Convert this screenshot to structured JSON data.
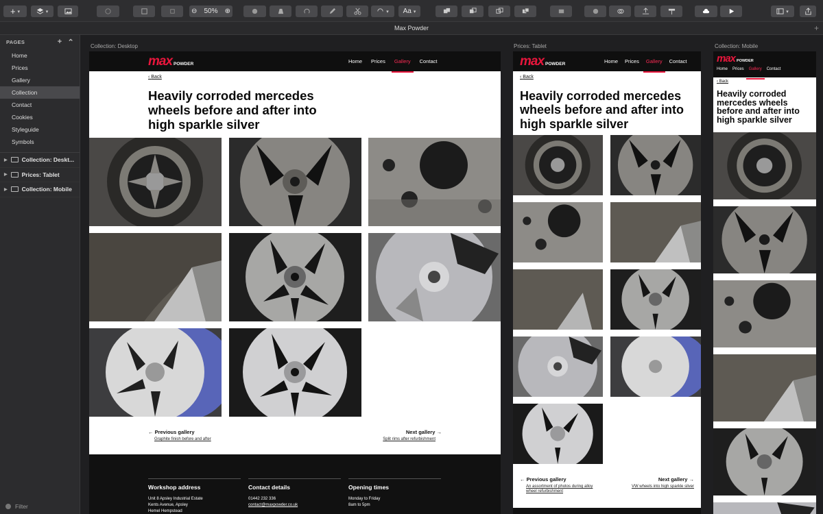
{
  "toolbar": {
    "zoom": "50%",
    "font_button": "Aa"
  },
  "document_title": "Max Powder",
  "sidebar": {
    "header": "PAGES",
    "pages": [
      "Home",
      "Prices",
      "Gallery",
      "Collection",
      "Contact",
      "Cookies",
      "Styleguide",
      "Symbols"
    ],
    "selected_page": "Collection",
    "layers": [
      "Collection: Deskt...",
      "Prices: Tablet",
      "Collection: Mobile"
    ],
    "filter": "Filter"
  },
  "artboards": {
    "desktop": {
      "label": "Collection: Desktop"
    },
    "tablet": {
      "label": "Prices: Tablet"
    },
    "mobile": {
      "label": "Collection: Mobile"
    }
  },
  "site": {
    "logo_big": "max",
    "logo_small": "POWDER",
    "nav": [
      "Home",
      "Prices",
      "Gallery",
      "Contact"
    ],
    "active_nav": "Gallery",
    "back": "Back",
    "title_line1": "Heavily corroded mercedes",
    "title_line2": "wheels before and after into",
    "title_line3": "high sparkle silver",
    "tablet_line1": "Heavily corroded mercedes",
    "tablet_line2": "wheels before and after into",
    "tablet_line3": "high sparkle silver",
    "mobile_line1": "Heavily corroded",
    "mobile_line2": "mercedes wheels",
    "mobile_line3": "before and after into",
    "mobile_line4": "high sparkle silver"
  },
  "desktop_pager": {
    "prev_label": "Previous gallery",
    "prev_link": "Graphite finish before and after",
    "next_label": "Next gallery",
    "next_link": "Split rims after refurbishment"
  },
  "tablet_pager": {
    "prev_label": "Previous gallery",
    "prev_link_1": "An assortment of photos during alloy",
    "prev_link_2": "wheel refurbishment",
    "next_label": "Next gallery",
    "next_link": "VW wheels into high sparkle silver"
  },
  "footer": {
    "col1_title": "Workshop address",
    "col1_l1": "Unit 8 Apsley Industrial Estate",
    "col1_l2": "Kents Avenue, Apsley",
    "col1_l3": "Hemel Hempstead",
    "col2_title": "Contact details",
    "col2_l1": "01442 232 336",
    "col2_l2": "contact@maxpowder.co.uk",
    "col3_title": "Opening times",
    "col3_l1": "Monday to Friday",
    "col3_l2": "8am to 5pm"
  }
}
